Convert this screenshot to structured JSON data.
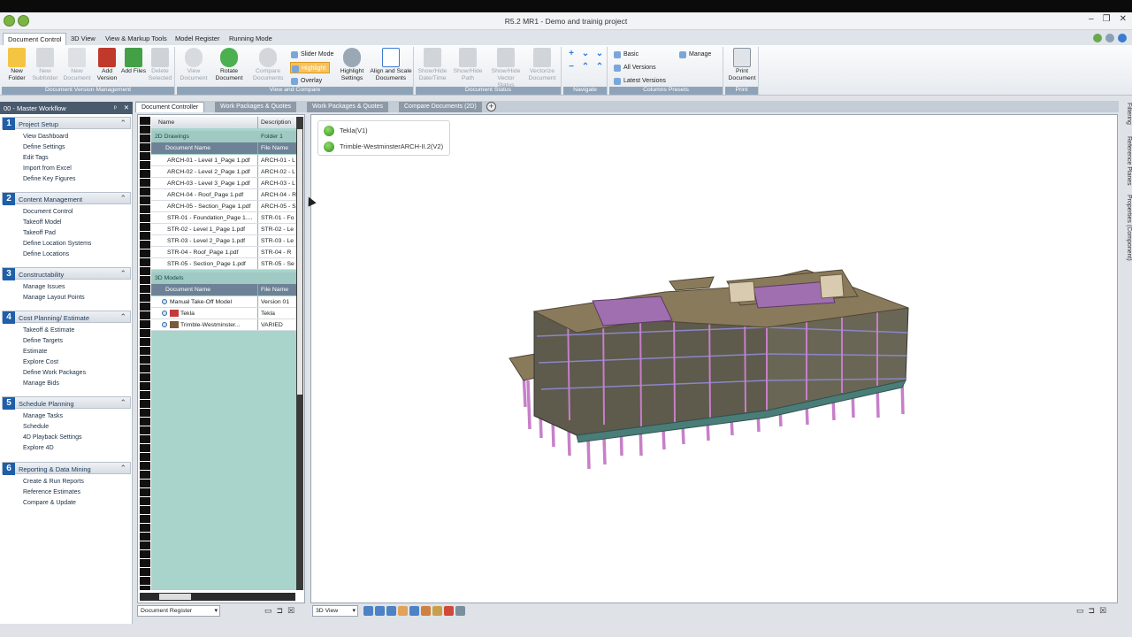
{
  "window": {
    "title": "R5.2 MR1 - Demo and trainig project"
  },
  "menu": {
    "tabs": [
      "Document Control",
      "3D View",
      "View & Markup Tools",
      "Model Register",
      "Running Mode"
    ],
    "active": 0
  },
  "ribbon": {
    "groups": [
      {
        "label": "Document Version Management",
        "buttons": [
          "New Folder",
          "New Subfolder",
          "New Document",
          "Add Version",
          "Add Files",
          "Delete Selected"
        ]
      },
      {
        "label": "View and Compare",
        "buttons": [
          "View Document",
          "Rotate Document",
          "Compare Documents"
        ],
        "small": [
          "Slider Mode",
          "Highlight",
          "Overlay"
        ],
        "more": [
          "Highlight Settings",
          "Align and Scale Documents"
        ]
      },
      {
        "label": "Document Status",
        "buttons": [
          "Show/Hide Date/Time",
          "Show/Hide Path",
          "Show/Hide Vector Status",
          "Vectorize Document"
        ]
      },
      {
        "label": "Navigate"
      },
      {
        "label": "Columns Presets",
        "small": [
          "Basic",
          "All Versions",
          "Latest Versions",
          "Manage"
        ]
      },
      {
        "label": "Print",
        "buttons": [
          "Print Document"
        ]
      }
    ]
  },
  "workflow": {
    "title": "00 - Master Workflow",
    "sections": [
      {
        "num": "1",
        "title": "Project Setup",
        "items": [
          "View Dashboard",
          "Define Settings",
          "Edit Tags",
          "Import from Excel",
          "Define Key Figures"
        ]
      },
      {
        "num": "2",
        "title": "Content Management",
        "items": [
          "Document Control",
          "Takeoff Model",
          "Takeoff Pad",
          "Define Location Systems",
          "Define Locations"
        ]
      },
      {
        "num": "3",
        "title": "Constructability",
        "items": [
          "Manage Issues",
          "Manage Layout Points"
        ]
      },
      {
        "num": "4",
        "title": "Cost Planning/ Estimate",
        "items": [
          "Takeoff & Estimate",
          "Define Targets",
          "Estimate",
          "Explore Cost",
          "Define Work Packages",
          "Manage Bids"
        ]
      },
      {
        "num": "5",
        "title": "Schedule Planning",
        "items": [
          "Manage Tasks",
          "Schedule",
          "4D Playback Settings",
          "Explore 4D"
        ]
      },
      {
        "num": "6",
        "title": "Reporting & Data Mining",
        "items": [
          "Create & Run Reports",
          "Reference Estimates",
          "Compare & Update"
        ]
      }
    ]
  },
  "doc_tabs": [
    "Document Controller",
    "Work Packages & Quotes",
    "Work Packages & Quotes",
    "Compare Documents (2D)"
  ],
  "grid": {
    "header": {
      "name": "Name",
      "description": "Description"
    },
    "group_2d": {
      "name": "2D Drawings",
      "description": "Folder 1"
    },
    "sub_header": {
      "name": "Document Name",
      "file": "File Name"
    },
    "docs_2d": [
      {
        "name": "ARCH-01 - Level 1_Page 1.pdf",
        "file": "ARCH-01 - L"
      },
      {
        "name": "ARCH-02 - Level 2_Page 1.pdf",
        "file": "ARCH-02 - L"
      },
      {
        "name": "ARCH-03 - Level 3_Page 1.pdf",
        "file": "ARCH-03 - L"
      },
      {
        "name": "ARCH-04 - Roof_Page 1.pdf",
        "file": "ARCH-04 - R"
      },
      {
        "name": "ARCH-05 - Section_Page 1.pdf",
        "file": "ARCH-05 - S"
      },
      {
        "name": "STR-01 - Foundation_Page 1....",
        "file": "STR-01 - Fo"
      },
      {
        "name": "STR-02 - Level 1_Page 1.pdf",
        "file": "STR-02 - Le"
      },
      {
        "name": "STR-03 - Level 2_Page 1.pdf",
        "file": "STR-03 - Le"
      },
      {
        "name": "STR-04 - Roof_Page 1.pdf",
        "file": "STR-04 - R"
      },
      {
        "name": "STR-05 - Section_Page 1.pdf",
        "file": "STR-05 - Se"
      }
    ],
    "group_3d": {
      "name": "3D Models"
    },
    "docs_3d": [
      {
        "name": "Manual Take-Off Model",
        "file": "Version 01"
      },
      {
        "name": "Tekla",
        "file": "Tekla"
      },
      {
        "name": "Trimble-Westminster...",
        "file": "VARIED"
      }
    ]
  },
  "lower": {
    "register_select": "Document Register",
    "view_select": "3D View"
  },
  "legend": [
    {
      "label": "Tekla(V1)"
    },
    {
      "label": "Trimble-WestminsterARCH-II.2(V2)"
    }
  ],
  "right_panel": [
    "Filtering",
    "Reference Planes",
    "Properties (Component)"
  ],
  "colors": {
    "accent": "#1f5fa9",
    "grid_bg": "#a8d4cc",
    "slab": "#8a7a5c",
    "column": "#c77fc9",
    "highlight": "#f8c25a"
  }
}
